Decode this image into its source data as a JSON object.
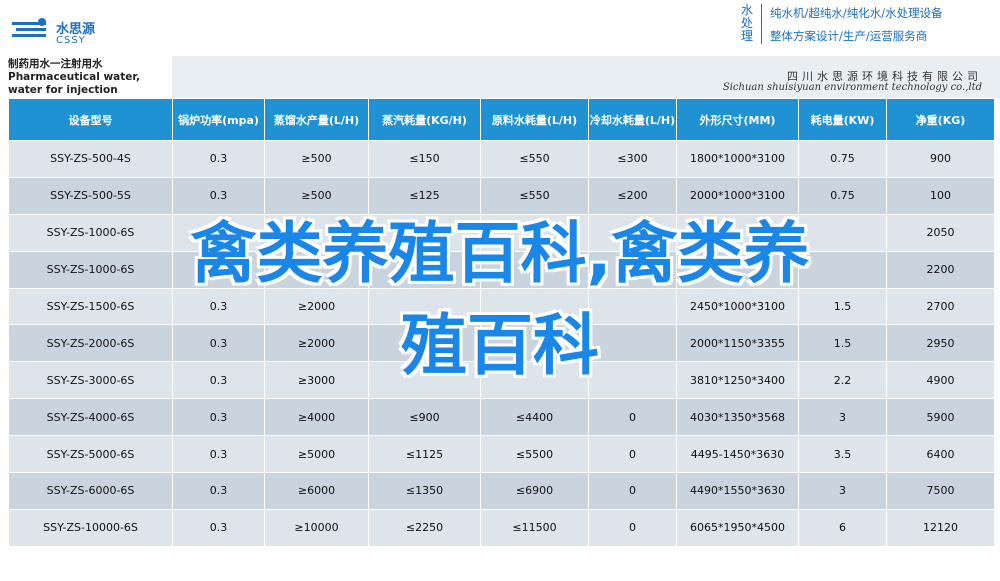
{
  "brand": {
    "name_cn": "水思源",
    "name_en": "CSSY",
    "tag_vertical": "水处理",
    "tagline_1": "纯水机/超纯水/纯化水/水处理设备",
    "tagline_2": "整体方案设计/生产/运营服务商"
  },
  "product": {
    "title": "制药用水一注射用水 Pharmaceutical water, water for injection"
  },
  "company": {
    "name_cn": "四川水思源环境科技有限公司",
    "name_en": "Sichuan shuisiyuan environment technology co.,ltd"
  },
  "table": {
    "headers": [
      "设备型号",
      "锅炉功率(mpa)",
      "蒸馏水产量(L/H)",
      "蒸汽耗量(KG/H)",
      "原料水耗量(L/H)",
      "冷却水耗量(L/H)",
      "外形尺寸(MM)",
      "耗电量(KW)",
      "净重(KG)"
    ],
    "rows": [
      [
        "SSY-ZS-500-4S",
        "0.3",
        "≥500",
        "≤150",
        "≤550",
        "≤300",
        "1800*1000*3100",
        "0.75",
        "900"
      ],
      [
        "SSY-ZS-500-5S",
        "0.3",
        "≥500",
        "≤125",
        "≤550",
        "≤200",
        "2000*1000*3100",
        "0.75",
        "100"
      ],
      [
        "SSY-ZS-1000-6S",
        "",
        "",
        "",
        "",
        "",
        "",
        "",
        "2050"
      ],
      [
        "SSY-ZS-1000-6S",
        "",
        "",
        "",
        "",
        "",
        "",
        "",
        "2200"
      ],
      [
        "SSY-ZS-1500-6S",
        "0.3",
        "≥2000",
        "",
        "",
        "",
        "2450*1000*3100",
        "1.5",
        "2700"
      ],
      [
        "SSY-ZS-2000-6S",
        "0.3",
        "≥2000",
        "",
        "",
        "",
        "2000*1150*3355",
        "1.5",
        "2950"
      ],
      [
        "SSY-ZS-3000-6S",
        "0.3",
        "≥3000",
        "",
        "",
        "",
        "3810*1250*3400",
        "2.2",
        "4900"
      ],
      [
        "SSY-ZS-4000-6S",
        "0.3",
        "≥4000",
        "≤900",
        "≤4400",
        "0",
        "4030*1350*3568",
        "3",
        "5900"
      ],
      [
        "SSY-ZS-5000-6S",
        "0.3",
        "≥5000",
        "≤1125",
        "≤5500",
        "0",
        "4495-1450*3630",
        "3.5",
        "6400"
      ],
      [
        "SSY-ZS-6000-6S",
        "0.3",
        "≥6000",
        "≤1350",
        "≤6900",
        "0",
        "4490*1550*3630",
        "3",
        "7500"
      ],
      [
        "SSY-ZS-10000-6S",
        "0.3",
        "≥10000",
        "≤2250",
        "≤11500",
        "0",
        "6065*1950*4500",
        "6",
        "12120"
      ]
    ]
  },
  "overlay": {
    "line1": "禽类养殖百科,禽类养",
    "line2": "殖百科"
  }
}
